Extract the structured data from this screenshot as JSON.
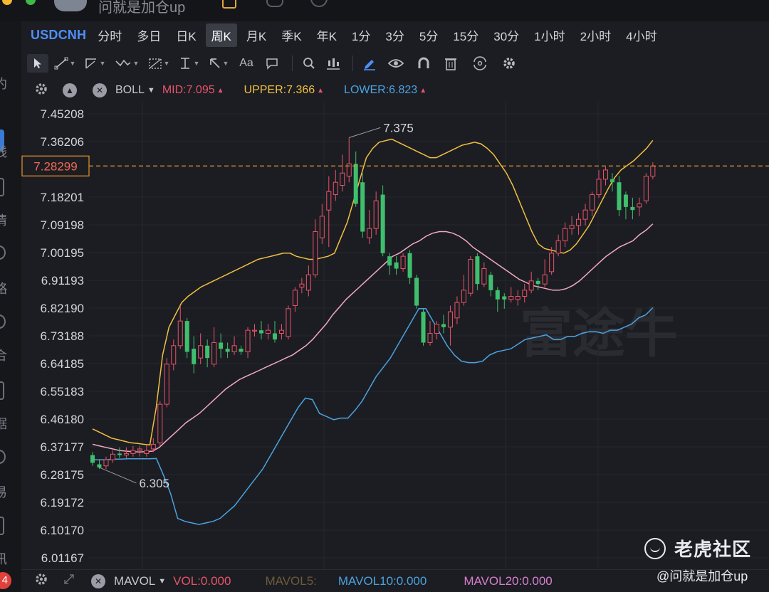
{
  "window": {
    "title": "问就是加仓up"
  },
  "left_sidebar": {
    "fragments": [
      "约",
      "线",
      "情",
      "略",
      "合",
      "据",
      "易",
      "讯"
    ],
    "badge": "4"
  },
  "symbol": "USDCNH",
  "periods": [
    "分时",
    "多日",
    "日K",
    "周K",
    "月K",
    "季K",
    "年K",
    "1分",
    "3分",
    "5分",
    "15分",
    "30分",
    "1小时",
    "2小时",
    "4小时"
  ],
  "active_period": "周K",
  "toolbar": {
    "text_tool_label": "Aa",
    "icons": [
      "cursor-icon",
      "trend-line-icon",
      "channel-icon",
      "wave-icon",
      "fib-icon",
      "measure-icon",
      "arrow-icon",
      "text-icon",
      "comment-icon",
      "search-icon",
      "chart-tool-icon",
      "pen-icon",
      "eye-icon",
      "magnet-icon",
      "trash-icon",
      "sync-icon",
      "gear-icon"
    ]
  },
  "indicator": {
    "name": "BOLL",
    "mid": "MID:7.095",
    "upper": "UPPER:7.366",
    "lower": "LOWER:6.823"
  },
  "volume_indicator": {
    "name": "MAVOL",
    "vol": "VOL:0.000",
    "mavol5": "MAVOL5:",
    "mavol10": "MAVOL10:0.000",
    "mavol20": "MAVOL20:0.000"
  },
  "watermark": {
    "brand": "老虎社区",
    "user": "@问就是加仓up",
    "background_brand": "富途牛"
  },
  "colors": {
    "up": "#e8536a",
    "down": "#3fbf6e",
    "upper": "#f0c040",
    "mid": "#f2a9c3",
    "lower": "#4aa3e0",
    "symbol": "#4e8ef7",
    "price_line": "#e8932b"
  },
  "chart_data": {
    "type": "candlestick",
    "ytick_labels": [
      "7.45208",
      "7.36206",
      "7.18201",
      "7.09198",
      "7.00195",
      "6.91193",
      "6.82190",
      "6.73188",
      "6.64185",
      "6.55183",
      "6.46180",
      "6.37177",
      "6.28175",
      "6.19172",
      "6.10170",
      "6.01167"
    ],
    "current_price": "7.28299",
    "ylim": [
      6.01167,
      7.45208
    ],
    "annotations": [
      {
        "label": "7.375",
        "value": 7.375,
        "kind": "high"
      },
      {
        "label": "6.305",
        "value": 6.305,
        "kind": "low"
      }
    ],
    "candles": [
      [
        6.345,
        6.32,
        6.355,
        6.31
      ],
      [
        6.315,
        6.305,
        6.33,
        6.3
      ],
      [
        6.31,
        6.33,
        6.34,
        6.3
      ],
      [
        6.33,
        6.348,
        6.36,
        6.32
      ],
      [
        6.35,
        6.345,
        6.37,
        6.335
      ],
      [
        6.345,
        6.35,
        6.37,
        6.335
      ],
      [
        6.35,
        6.36,
        6.375,
        6.34
      ],
      [
        6.36,
        6.365,
        6.375,
        6.34
      ],
      [
        6.35,
        6.36,
        6.38,
        6.34
      ],
      [
        6.365,
        6.38,
        6.4,
        6.355
      ],
      [
        6.385,
        6.51,
        6.52,
        6.375
      ],
      [
        6.51,
        6.64,
        6.66,
        6.5
      ],
      [
        6.64,
        6.7,
        6.72,
        6.62
      ],
      [
        6.7,
        6.78,
        6.83,
        6.69
      ],
      [
        6.78,
        6.68,
        6.79,
        6.66
      ],
      [
        6.69,
        6.64,
        6.73,
        6.61
      ],
      [
        6.66,
        6.7,
        6.74,
        6.64
      ],
      [
        6.7,
        6.66,
        6.72,
        6.63
      ],
      [
        6.64,
        6.71,
        6.76,
        6.63
      ],
      [
        6.71,
        6.69,
        6.74,
        6.66
      ],
      [
        6.69,
        6.68,
        6.71,
        6.66
      ],
      [
        6.68,
        6.7,
        6.73,
        6.67
      ],
      [
        6.69,
        6.68,
        6.7,
        6.67
      ],
      [
        6.68,
        6.75,
        6.76,
        6.66
      ],
      [
        6.75,
        6.75,
        6.77,
        6.73
      ],
      [
        6.75,
        6.74,
        6.78,
        6.72
      ],
      [
        6.74,
        6.75,
        6.77,
        6.72
      ],
      [
        6.74,
        6.72,
        6.78,
        6.71
      ],
      [
        6.74,
        6.75,
        6.77,
        6.72
      ],
      [
        6.73,
        6.82,
        6.83,
        6.72
      ],
      [
        6.83,
        6.88,
        6.89,
        6.81
      ],
      [
        6.89,
        6.9,
        6.92,
        6.87
      ],
      [
        6.88,
        6.93,
        6.96,
        6.86
      ],
      [
        6.93,
        7.07,
        7.11,
        6.92
      ],
      [
        7.05,
        7.12,
        7.16,
        7.03
      ],
      [
        7.14,
        7.2,
        7.25,
        7.02
      ],
      [
        7.19,
        7.23,
        7.27,
        7.17
      ],
      [
        7.22,
        7.26,
        7.32,
        7.2
      ],
      [
        7.25,
        7.29,
        7.375,
        7.23
      ],
      [
        7.29,
        7.16,
        7.33,
        7.15
      ],
      [
        7.23,
        7.07,
        7.26,
        7.05
      ],
      [
        7.05,
        7.08,
        7.14,
        7.03
      ],
      [
        7.08,
        7.17,
        7.2,
        7.06
      ],
      [
        7.19,
        7.0,
        7.22,
        6.99
      ],
      [
        6.99,
        6.96,
        7.0,
        6.93
      ],
      [
        6.97,
        6.95,
        6.99,
        6.93
      ],
      [
        6.95,
        6.99,
        7.0,
        6.94
      ],
      [
        7.0,
        6.92,
        7.01,
        6.9
      ],
      [
        6.92,
        6.83,
        6.93,
        6.82
      ],
      [
        6.81,
        6.71,
        6.82,
        6.7
      ],
      [
        6.71,
        6.74,
        6.78,
        6.7
      ],
      [
        6.74,
        6.77,
        6.78,
        6.72
      ],
      [
        6.77,
        6.76,
        6.8,
        6.74
      ],
      [
        6.76,
        6.81,
        6.83,
        6.7
      ],
      [
        6.79,
        6.84,
        6.86,
        6.77
      ],
      [
        6.84,
        6.88,
        6.93,
        6.83
      ],
      [
        6.87,
        6.98,
        6.99,
        6.86
      ],
      [
        6.99,
        6.9,
        7.0,
        6.88
      ],
      [
        6.9,
        6.95,
        6.97,
        6.89
      ],
      [
        6.93,
        6.88,
        6.94,
        6.86
      ],
      [
        6.88,
        6.85,
        6.89,
        6.81
      ],
      [
        6.86,
        6.85,
        6.87,
        6.82
      ],
      [
        6.85,
        6.86,
        6.89,
        6.84
      ],
      [
        6.85,
        6.86,
        6.88,
        6.83
      ],
      [
        6.86,
        6.88,
        6.9,
        6.84
      ],
      [
        6.88,
        6.91,
        6.94,
        6.87
      ],
      [
        6.91,
        6.9,
        6.92,
        6.88
      ],
      [
        6.9,
        6.93,
        6.98,
        6.89
      ],
      [
        6.94,
        7.0,
        7.02,
        6.93
      ],
      [
        7.0,
        7.04,
        7.06,
        6.99
      ],
      [
        7.04,
        7.08,
        7.1,
        7.02
      ],
      [
        7.08,
        7.09,
        7.12,
        7.06
      ],
      [
        7.09,
        7.11,
        7.13,
        7.06
      ],
      [
        7.11,
        7.14,
        7.16,
        7.09
      ],
      [
        7.14,
        7.19,
        7.2,
        7.12
      ],
      [
        7.19,
        7.24,
        7.27,
        7.18
      ],
      [
        7.24,
        7.27,
        7.28,
        7.22
      ],
      [
        7.24,
        7.23,
        7.26,
        7.2
      ],
      [
        7.23,
        7.14,
        7.25,
        7.12
      ],
      [
        7.19,
        7.15,
        7.2,
        7.11
      ],
      [
        7.15,
        7.14,
        7.18,
        7.11
      ],
      [
        7.15,
        7.16,
        7.18,
        7.12
      ],
      [
        7.17,
        7.25,
        7.26,
        7.16
      ],
      [
        7.25,
        7.283,
        7.295,
        7.24
      ]
    ],
    "bands": {
      "upper": [
        6.43,
        6.42,
        6.41,
        6.4,
        6.395,
        6.39,
        6.385,
        6.383,
        6.38,
        6.378,
        6.5,
        6.67,
        6.76,
        6.8,
        6.84,
        6.86,
        6.875,
        6.89,
        6.9,
        6.91,
        6.92,
        6.93,
        6.94,
        6.95,
        6.96,
        6.97,
        6.98,
        6.985,
        6.99,
        6.995,
        7.0,
        7.0,
        6.99,
        6.985,
        6.98,
        6.98,
        6.985,
        6.99,
        7.0,
        7.05,
        7.1,
        7.17,
        7.24,
        7.31,
        7.34,
        7.36,
        7.365,
        7.37,
        7.36,
        7.35,
        7.34,
        7.33,
        7.32,
        7.31,
        7.31,
        7.32,
        7.33,
        7.34,
        7.35,
        7.355,
        7.36,
        7.355,
        7.34,
        7.32,
        7.29,
        7.26,
        7.22,
        7.17,
        7.12,
        7.07,
        7.03,
        7.015,
        7.01,
        7.005,
        7.0,
        7.01,
        7.03,
        7.06,
        7.09,
        7.13,
        7.17,
        7.21,
        7.245,
        7.27,
        7.285,
        7.3,
        7.32,
        7.34,
        7.366
      ],
      "mid": [
        6.38,
        6.375,
        6.37,
        6.365,
        6.36,
        6.358,
        6.356,
        6.355,
        6.356,
        6.358,
        6.37,
        6.39,
        6.41,
        6.43,
        6.45,
        6.465,
        6.48,
        6.5,
        6.52,
        6.54,
        6.56,
        6.575,
        6.59,
        6.6,
        6.61,
        6.62,
        6.63,
        6.64,
        6.65,
        6.66,
        6.67,
        6.685,
        6.7,
        6.72,
        6.745,
        6.77,
        6.8,
        6.825,
        6.85,
        6.87,
        6.89,
        6.91,
        6.93,
        6.95,
        6.97,
        6.99,
        7.0,
        7.015,
        7.03,
        7.04,
        7.055,
        7.065,
        7.07,
        7.07,
        7.065,
        7.055,
        7.04,
        7.02,
        7.005,
        6.99,
        6.975,
        6.96,
        6.945,
        6.93,
        6.915,
        6.905,
        6.895,
        6.89,
        6.885,
        6.88,
        6.88,
        6.885,
        6.895,
        6.91,
        6.93,
        6.95,
        6.97,
        6.99,
        7.005,
        7.02,
        7.03,
        7.04,
        7.06,
        7.075,
        7.095
      ],
      "lower": [
        6.33,
        6.33,
        6.33,
        6.332,
        6.332,
        6.333,
        6.333,
        6.333,
        6.333,
        6.334,
        6.28,
        6.22,
        6.14,
        6.13,
        6.125,
        6.12,
        6.125,
        6.13,
        6.14,
        6.16,
        6.18,
        6.21,
        6.24,
        6.27,
        6.3,
        6.34,
        6.38,
        6.42,
        6.46,
        6.5,
        6.53,
        6.525,
        6.48,
        6.47,
        6.46,
        6.465,
        6.465,
        6.49,
        6.52,
        6.56,
        6.6,
        6.63,
        6.66,
        6.7,
        6.74,
        6.78,
        6.82,
        6.82,
        6.78,
        6.74,
        6.7,
        6.67,
        6.65,
        6.645,
        6.645,
        6.65,
        6.67,
        6.68,
        6.685,
        6.69,
        6.705,
        6.72,
        6.725,
        6.73,
        6.735,
        6.72,
        6.72,
        6.73,
        6.73,
        6.74,
        6.745,
        6.745,
        6.74,
        6.75,
        6.75,
        6.76,
        6.77,
        6.79,
        6.8,
        6.823
      ]
    }
  }
}
